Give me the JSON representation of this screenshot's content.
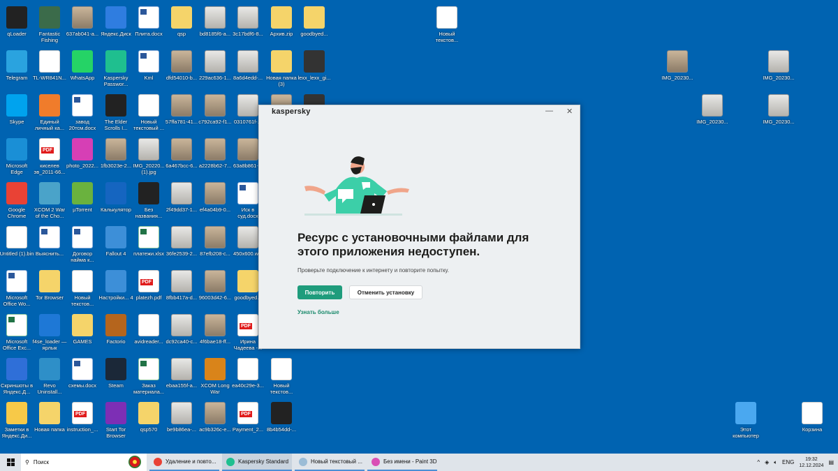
{
  "desktop": {
    "columns": [
      [
        {
          "l": "qLoader",
          "t": "app",
          "c": "#222"
        },
        {
          "l": "Telegram",
          "t": "app",
          "c": "#2aa3df"
        },
        {
          "l": "Skype",
          "t": "app",
          "c": "#00a3ee"
        },
        {
          "l": "Microsoft Edge",
          "t": "app",
          "c": "#1a8fd6"
        },
        {
          "l": "Google Chrome",
          "t": "app",
          "c": "#e94235"
        },
        {
          "l": "Untitled (1).bin",
          "t": "doc"
        },
        {
          "l": "Microsoft Office Wo...",
          "t": "word"
        },
        {
          "l": "Microsoft Office Exc...",
          "t": "xls"
        },
        {
          "l": "Скриншоты в Яндекс.Д...",
          "t": "app",
          "c": "#2f6fd8"
        },
        {
          "l": "Заметки в Яндекс.Ди...",
          "t": "app",
          "c": "#f7c948"
        }
      ],
      [
        {
          "l": "Fantastic Fishing",
          "t": "app",
          "c": "#3b6b4a"
        },
        {
          "l": "TL-WR841N...",
          "t": "doc"
        },
        {
          "l": "Единый личный ка...",
          "t": "app",
          "c": "#f07c2b"
        },
        {
          "l": "киселев эв_2011-66...",
          "t": "pdf"
        },
        {
          "l": "XCOM 2 War of the Cho...",
          "t": "app",
          "c": "#4aa3c9"
        },
        {
          "l": "Выяснить...",
          "t": "word"
        },
        {
          "l": "Tor Browser",
          "t": "folder"
        },
        {
          "l": "f4se_loader — ярлык",
          "t": "app",
          "c": "#1e78d6"
        },
        {
          "l": "Revo Uninstall...",
          "t": "app",
          "c": "#2e8fc8"
        },
        {
          "l": "Новая папка",
          "t": "folder"
        }
      ],
      [
        {
          "l": "637ab041-a...",
          "t": "photo"
        },
        {
          "l": "WhatsApp",
          "t": "app",
          "c": "#25d366"
        },
        {
          "l": "завод 20тсм.docx",
          "t": "word"
        },
        {
          "l": "photo_2022...",
          "t": "app",
          "c": "#d63fb5"
        },
        {
          "l": "µTorrent",
          "t": "app",
          "c": "#6ab23e"
        },
        {
          "l": "Договор найма к...",
          "t": "word"
        },
        {
          "l": "Новый текстов...",
          "t": "doc"
        },
        {
          "l": "GAMES",
          "t": "folder"
        },
        {
          "l": "схемы.docx",
          "t": "word"
        },
        {
          "l": "instruction_...",
          "t": "pdf"
        }
      ],
      [
        {
          "l": "Яндекс.Диск",
          "t": "app",
          "c": "#2f7de0"
        },
        {
          "l": "Kaspersky Passwor...",
          "t": "app",
          "c": "#1fbf8f"
        },
        {
          "l": "The Elder Scrolls I...",
          "t": "dark"
        },
        {
          "l": "1fb3023e-2...",
          "t": "photo"
        },
        {
          "l": "Калькулятор",
          "t": "app",
          "c": "#1565c0"
        },
        {
          "l": "Fallout 4",
          "t": "app",
          "c": "#3d8fd8"
        },
        {
          "l": "Настройки... 4",
          "t": "app",
          "c": "#3d8fd8"
        },
        {
          "l": "Factorio",
          "t": "app",
          "c": "#b5651d"
        },
        {
          "l": "Steam",
          "t": "app",
          "c": "#1b2838"
        },
        {
          "l": "Start Tor Browser",
          "t": "app",
          "c": "#7d2fb5"
        }
      ],
      [
        {
          "l": "Плита.docx",
          "t": "word"
        },
        {
          "l": "Kml",
          "t": "word"
        },
        {
          "l": "Новый текстовый ...",
          "t": "doc"
        },
        {
          "l": "IMG_20220... (1).jpg",
          "t": "scan"
        },
        {
          "l": "Без названия...",
          "t": "dark"
        },
        {
          "l": "платежи.xlsx",
          "t": "xls"
        },
        {
          "l": "platezh.pdf",
          "t": "pdf"
        },
        {
          "l": "avidreader...",
          "t": "doc"
        },
        {
          "l": "Заказ материала...",
          "t": "xls"
        },
        {
          "l": "qsp570",
          "t": "folder"
        }
      ],
      [
        {
          "l": "qsp",
          "t": "folder"
        },
        {
          "l": "dfd54010-b...",
          "t": "photo"
        },
        {
          "l": "57ffa781-41...",
          "t": "photo"
        },
        {
          "l": "6a467bcc-6...",
          "t": "photo"
        },
        {
          "l": "2f49dd37-1...",
          "t": "scan"
        },
        {
          "l": "36fe2539-2...",
          "t": "scan"
        },
        {
          "l": "8fbb417a-d...",
          "t": "scan"
        },
        {
          "l": "dc92ca40-c...",
          "t": "scan"
        },
        {
          "l": "ebaa155f-a...",
          "t": "scan"
        },
        {
          "l": "be9b86ea-...",
          "t": "scan"
        }
      ],
      [
        {
          "l": "bd8185f6-a...",
          "t": "scan"
        },
        {
          "l": "229ac636-1...",
          "t": "scan"
        },
        {
          "l": "c792ca92-f1...",
          "t": "photo"
        },
        {
          "l": "a2228b62-7...",
          "t": "photo"
        },
        {
          "l": "ef4a04b9-0...",
          "t": "photo"
        },
        {
          "l": "87efb208-c...",
          "t": "photo"
        },
        {
          "l": "96003d42-6...",
          "t": "photo"
        },
        {
          "l": "4f6bae18-ff...",
          "t": "photo"
        },
        {
          "l": "XCOM Long War",
          "t": "app",
          "c": "#d9841a"
        },
        {
          "l": "ac9b326c-e...",
          "t": "photo"
        }
      ],
      [
        {
          "l": "3c17bdf6-8...",
          "t": "scan"
        },
        {
          "l": "8a6d4edd-...",
          "t": "scan"
        },
        {
          "l": "0310761f-...",
          "t": "scan"
        },
        {
          "l": "63a8b861-...",
          "t": "photo"
        },
        {
          "l": "Иск в суд.docx",
          "t": "word"
        },
        {
          "l": "450x600.w...",
          "t": "scan"
        },
        {
          "l": "goodbyed...",
          "t": "folder"
        },
        {
          "l": "Ирина Чадеева -...",
          "t": "pdf"
        },
        {
          "l": "ea40c29e-3...",
          "t": "doc"
        },
        {
          "l": "Payment_2...",
          "t": "pdf"
        }
      ],
      [
        {
          "l": "Архив.zip",
          "t": "folder"
        },
        {
          "l": "Новая папка (3)",
          "t": "folder"
        },
        {
          "l": "",
          "t": "photo"
        },
        null,
        null,
        null,
        null,
        null,
        {
          "l": "Новый текстов...",
          "t": "doc"
        },
        {
          "l": "8b4b54dd-...",
          "t": "dark"
        }
      ],
      [
        {
          "l": "goodbyed...",
          "t": "folder"
        },
        {
          "l": "lexx_lexx_gi...",
          "t": "app",
          "c": "#333"
        },
        {
          "l": "",
          "t": "app",
          "c": "#333"
        },
        null,
        null,
        null,
        null,
        null,
        null,
        null
      ]
    ],
    "extra": [
      {
        "l": "Новый текстов...",
        "t": "doc",
        "pos": "a"
      },
      {
        "l": "IMG_20230...",
        "t": "photo",
        "pos": "b"
      },
      {
        "l": "IMG_20230...",
        "t": "scan",
        "pos": "c"
      },
      {
        "l": "IMG_20230...",
        "t": "scan",
        "pos": "d"
      },
      {
        "l": "IMG_20230...",
        "t": "scan",
        "pos": "e"
      },
      {
        "l": "Этот компьютер",
        "t": "app",
        "c": "#4aa8f0",
        "pos": "f"
      },
      {
        "l": "Корзина",
        "t": "doc",
        "pos": "g"
      }
    ]
  },
  "dialog": {
    "brand": "kaspersky",
    "minimize": "—",
    "close": "✕",
    "title": "Ресурс с установочными файлами для этого приложения недоступен.",
    "subtitle": "Проверьте подключение к интернету и повторите попытку.",
    "retry": "Повторить",
    "cancel": "Отменить установку",
    "learn_more": "Узнать больше",
    "accent": "#1f9c7c"
  },
  "taskbar": {
    "search_placeholder": "Поиск",
    "tasks": [
      {
        "label": "Удаление и повто...",
        "color": "#e94235"
      },
      {
        "label": "Kaspersky Standard",
        "color": "#1fbf8f"
      },
      {
        "label": "Новый текстовый ...",
        "color": "#9bbcd6"
      },
      {
        "label": "Без имени - Paint 3D",
        "color": "#d94fb5"
      }
    ],
    "lang": "ENG",
    "time": "19:32",
    "date": "12.12.2024"
  }
}
